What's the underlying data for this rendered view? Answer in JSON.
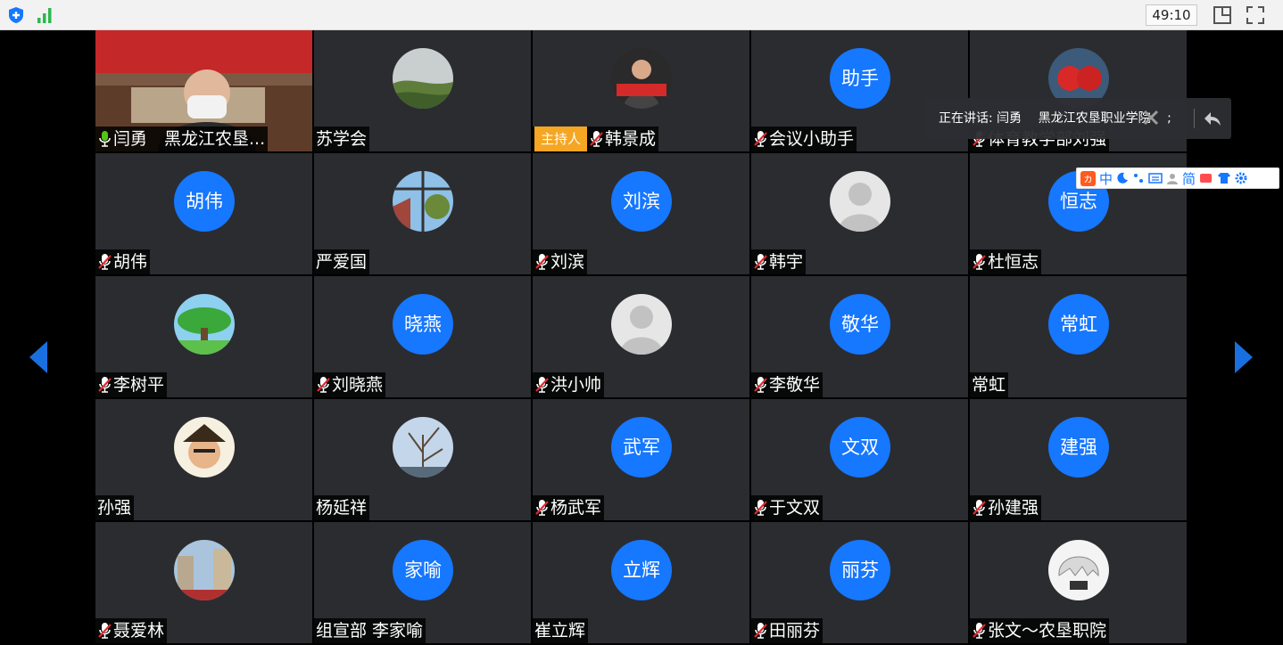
{
  "topbar": {
    "timer": "49:10"
  },
  "speaker": {
    "prefix": "正在讲话: 闫勇",
    "org": "黑龙江农垦职业学院",
    "sep": ";"
  },
  "ime": {
    "logo": "ヵ",
    "lang": "中",
    "simplified": "简"
  },
  "tiles": [
    {
      "name": "闫勇　黑龙江农垦...",
      "avatar_text": "",
      "kind": "video",
      "mic": "on"
    },
    {
      "name": "苏学会",
      "avatar_text": "",
      "kind": "photo-hill",
      "mic": "none"
    },
    {
      "name": "韩景成",
      "avatar_text": "",
      "kind": "photo-man",
      "mic": "muted",
      "badge": "主持人"
    },
    {
      "name": "会议小助手",
      "avatar_text": "助手",
      "kind": "text",
      "mic": "muted"
    },
    {
      "name": "体育教学部刘强",
      "avatar_text": "",
      "kind": "photo-red",
      "mic": "muted"
    },
    {
      "name": "胡伟",
      "avatar_text": "胡伟",
      "kind": "text",
      "mic": "muted"
    },
    {
      "name": "严爱国",
      "avatar_text": "",
      "kind": "photo-window",
      "mic": "none"
    },
    {
      "name": "刘滨",
      "avatar_text": "刘滨",
      "kind": "text",
      "mic": "muted"
    },
    {
      "name": "韩宇",
      "avatar_text": "",
      "kind": "default",
      "mic": "muted"
    },
    {
      "name": "杜恒志",
      "avatar_text": "恒志",
      "kind": "text",
      "mic": "muted"
    },
    {
      "name": "李树平",
      "avatar_text": "",
      "kind": "photo-tree",
      "mic": "muted"
    },
    {
      "name": "刘晓燕",
      "avatar_text": "晓燕",
      "kind": "text",
      "mic": "muted"
    },
    {
      "name": "洪小帅",
      "avatar_text": "",
      "kind": "default",
      "mic": "muted"
    },
    {
      "name": "李敬华",
      "avatar_text": "敬华",
      "kind": "text",
      "mic": "muted"
    },
    {
      "name": "常虹",
      "avatar_text": "常虹",
      "kind": "text",
      "mic": "none"
    },
    {
      "name": "孙强",
      "avatar_text": "",
      "kind": "photo-pirate",
      "mic": "none"
    },
    {
      "name": "杨延祥",
      "avatar_text": "",
      "kind": "photo-sky",
      "mic": "none"
    },
    {
      "name": "杨武军",
      "avatar_text": "武军",
      "kind": "text",
      "mic": "muted"
    },
    {
      "name": "于文双",
      "avatar_text": "文双",
      "kind": "text",
      "mic": "muted"
    },
    {
      "name": "孙建强",
      "avatar_text": "建强",
      "kind": "text",
      "mic": "muted"
    },
    {
      "name": "聂爱林",
      "avatar_text": "",
      "kind": "photo-street",
      "mic": "muted"
    },
    {
      "name": "组宣部 李家喻",
      "avatar_text": "家喻",
      "kind": "text",
      "mic": "none"
    },
    {
      "name": "崔立辉",
      "avatar_text": "立辉",
      "kind": "text",
      "mic": "none"
    },
    {
      "name": "田丽芬",
      "avatar_text": "丽芬",
      "kind": "text",
      "mic": "muted"
    },
    {
      "name": "张文～农垦职院",
      "avatar_text": "",
      "kind": "photo-anime",
      "mic": "muted"
    }
  ],
  "colors": {
    "accent": "#1677ff",
    "tile_bg": "#2b2c30",
    "host_badge": "#f5a623",
    "mic_on": "#52c41a"
  }
}
